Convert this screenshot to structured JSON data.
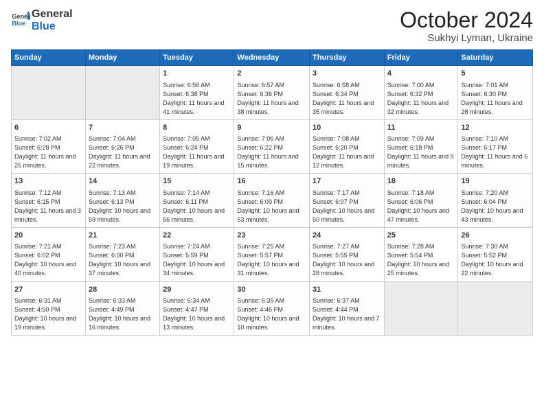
{
  "header": {
    "logo_general": "General",
    "logo_blue": "Blue",
    "month_title": "October 2024",
    "subtitle": "Sukhyi Lyman, Ukraine"
  },
  "days_of_week": [
    "Sunday",
    "Monday",
    "Tuesday",
    "Wednesday",
    "Thursday",
    "Friday",
    "Saturday"
  ],
  "weeks": [
    [
      {
        "day": "",
        "info": ""
      },
      {
        "day": "",
        "info": ""
      },
      {
        "day": "1",
        "info": "Sunrise: 6:56 AM\nSunset: 6:38 PM\nDaylight: 11 hours and 41 minutes."
      },
      {
        "day": "2",
        "info": "Sunrise: 6:57 AM\nSunset: 6:36 PM\nDaylight: 11 hours and 38 minutes."
      },
      {
        "day": "3",
        "info": "Sunrise: 6:58 AM\nSunset: 6:34 PM\nDaylight: 11 hours and 35 minutes."
      },
      {
        "day": "4",
        "info": "Sunrise: 7:00 AM\nSunset: 6:32 PM\nDaylight: 11 hours and 32 minutes."
      },
      {
        "day": "5",
        "info": "Sunrise: 7:01 AM\nSunset: 6:30 PM\nDaylight: 11 hours and 28 minutes."
      }
    ],
    [
      {
        "day": "6",
        "info": "Sunrise: 7:02 AM\nSunset: 6:28 PM\nDaylight: 11 hours and 25 minutes."
      },
      {
        "day": "7",
        "info": "Sunrise: 7:04 AM\nSunset: 6:26 PM\nDaylight: 11 hours and 22 minutes."
      },
      {
        "day": "8",
        "info": "Sunrise: 7:05 AM\nSunset: 6:24 PM\nDaylight: 11 hours and 19 minutes."
      },
      {
        "day": "9",
        "info": "Sunrise: 7:06 AM\nSunset: 6:22 PM\nDaylight: 11 hours and 15 minutes."
      },
      {
        "day": "10",
        "info": "Sunrise: 7:08 AM\nSunset: 6:20 PM\nDaylight: 11 hours and 12 minutes."
      },
      {
        "day": "11",
        "info": "Sunrise: 7:09 AM\nSunset: 6:18 PM\nDaylight: 11 hours and 9 minutes."
      },
      {
        "day": "12",
        "info": "Sunrise: 7:10 AM\nSunset: 6:17 PM\nDaylight: 11 hours and 6 minutes."
      }
    ],
    [
      {
        "day": "13",
        "info": "Sunrise: 7:12 AM\nSunset: 6:15 PM\nDaylight: 11 hours and 3 minutes."
      },
      {
        "day": "14",
        "info": "Sunrise: 7:13 AM\nSunset: 6:13 PM\nDaylight: 10 hours and 59 minutes."
      },
      {
        "day": "15",
        "info": "Sunrise: 7:14 AM\nSunset: 6:11 PM\nDaylight: 10 hours and 56 minutes."
      },
      {
        "day": "16",
        "info": "Sunrise: 7:16 AM\nSunset: 6:09 PM\nDaylight: 10 hours and 53 minutes."
      },
      {
        "day": "17",
        "info": "Sunrise: 7:17 AM\nSunset: 6:07 PM\nDaylight: 10 hours and 50 minutes."
      },
      {
        "day": "18",
        "info": "Sunrise: 7:18 AM\nSunset: 6:06 PM\nDaylight: 10 hours and 47 minutes."
      },
      {
        "day": "19",
        "info": "Sunrise: 7:20 AM\nSunset: 6:04 PM\nDaylight: 10 hours and 43 minutes."
      }
    ],
    [
      {
        "day": "20",
        "info": "Sunrise: 7:21 AM\nSunset: 6:02 PM\nDaylight: 10 hours and 40 minutes."
      },
      {
        "day": "21",
        "info": "Sunrise: 7:23 AM\nSunset: 6:00 PM\nDaylight: 10 hours and 37 minutes."
      },
      {
        "day": "22",
        "info": "Sunrise: 7:24 AM\nSunset: 5:59 PM\nDaylight: 10 hours and 34 minutes."
      },
      {
        "day": "23",
        "info": "Sunrise: 7:25 AM\nSunset: 5:57 PM\nDaylight: 10 hours and 31 minutes."
      },
      {
        "day": "24",
        "info": "Sunrise: 7:27 AM\nSunset: 5:55 PM\nDaylight: 10 hours and 28 minutes."
      },
      {
        "day": "25",
        "info": "Sunrise: 7:28 AM\nSunset: 5:54 PM\nDaylight: 10 hours and 25 minutes."
      },
      {
        "day": "26",
        "info": "Sunrise: 7:30 AM\nSunset: 5:52 PM\nDaylight: 10 hours and 22 minutes."
      }
    ],
    [
      {
        "day": "27",
        "info": "Sunrise: 6:31 AM\nSunset: 4:50 PM\nDaylight: 10 hours and 19 minutes."
      },
      {
        "day": "28",
        "info": "Sunrise: 6:33 AM\nSunset: 4:49 PM\nDaylight: 10 hours and 16 minutes."
      },
      {
        "day": "29",
        "info": "Sunrise: 6:34 AM\nSunset: 4:47 PM\nDaylight: 10 hours and 13 minutes."
      },
      {
        "day": "30",
        "info": "Sunrise: 6:35 AM\nSunset: 4:46 PM\nDaylight: 10 hours and 10 minutes."
      },
      {
        "day": "31",
        "info": "Sunrise: 6:37 AM\nSunset: 4:44 PM\nDaylight: 10 hours and 7 minutes."
      },
      {
        "day": "",
        "info": ""
      },
      {
        "day": "",
        "info": ""
      }
    ]
  ]
}
